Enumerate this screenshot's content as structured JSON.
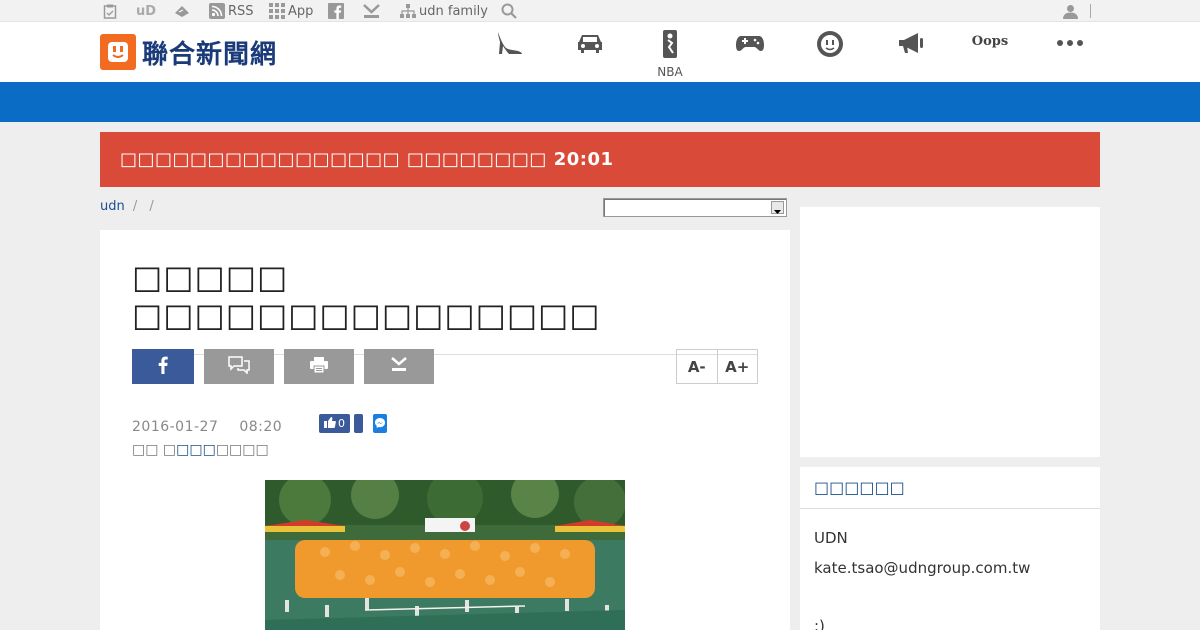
{
  "topbar": {
    "ud_label": "uD",
    "rss_label": "RSS",
    "app_label": "App",
    "family_label": "udn family"
  },
  "header": {
    "logo_text": "聯合新聞網",
    "nav": [
      {
        "icon": "high-heel-icon",
        "caption": ""
      },
      {
        "icon": "car-icon",
        "caption": ""
      },
      {
        "icon": "nba-icon",
        "caption": "NBA"
      },
      {
        "icon": "gamepad-icon",
        "caption": ""
      },
      {
        "icon": "socket-icon",
        "caption": ""
      },
      {
        "icon": "megaphone-icon",
        "caption": ""
      },
      {
        "icon": "oops-icon",
        "caption": "Oops"
      },
      {
        "icon": "more-icon",
        "caption": "•••"
      }
    ]
  },
  "alert": {
    "text": "□□□□□□□□□□□□□□□□ □□□□□□□□ 20:01"
  },
  "breadcrumb": {
    "home": "udn",
    "sep1": "/",
    "sep2": "/"
  },
  "article": {
    "title": "□□□□□ □□□□□□□□□□□□□□□",
    "date": "2016-01-27",
    "time": "08:20",
    "like_count": "0",
    "byline_prefix": "□□ □",
    "byline_link": "□□□",
    "byline_suffix": "□□□□",
    "font_decrease": "A-",
    "font_increase": "A+"
  },
  "sidebar": {
    "box_title": "□□□□□□",
    "line1": "UDN",
    "line2": "kate.tsao@udngroup.com.tw",
    "line3": ":)"
  },
  "colors": {
    "brand_orange": "#f26b21",
    "band_blue": "#0a6cc4",
    "alert_red": "#d94a38",
    "facebook_blue": "#3b5a9a",
    "share_gray": "#999999"
  }
}
